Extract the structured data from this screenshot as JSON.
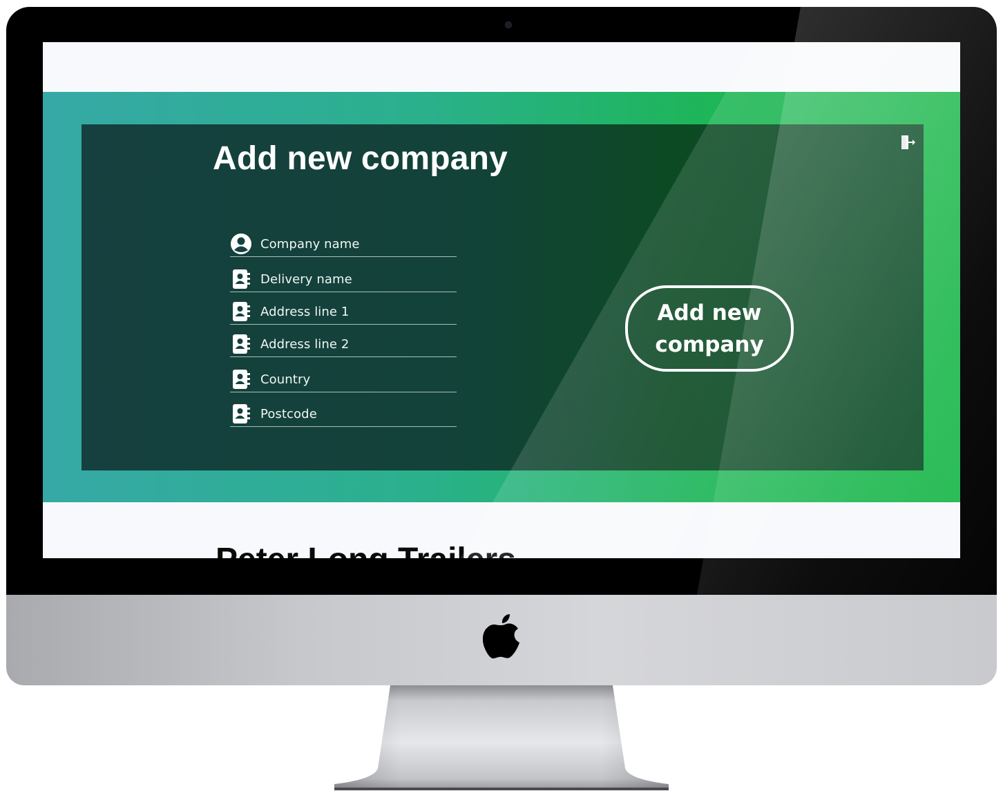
{
  "panel": {
    "title": "Add new company"
  },
  "form": {
    "fields": [
      {
        "label": "Company name",
        "icon": "user-circle-icon"
      },
      {
        "label": "Delivery name",
        "icon": "contact-book-icon"
      },
      {
        "label": "Address line 1",
        "icon": "contact-book-icon"
      },
      {
        "label": "Address line 2",
        "icon": "contact-book-icon"
      },
      {
        "label": "Country",
        "icon": "contact-book-icon"
      },
      {
        "label": "Postcode",
        "icon": "contact-book-icon"
      }
    ]
  },
  "actions": {
    "add_company_label_line1": "Add new",
    "add_company_label_line2": "company",
    "logout_icon": "logout-door-icon"
  },
  "below": {
    "heading": "Peter Long Trailers"
  },
  "colors": {
    "hero_gradient_start": "#36a9a6",
    "hero_gradient_end": "#1eb84d",
    "panel_dark": "#15403f",
    "panel_green": "#0c4a24"
  }
}
